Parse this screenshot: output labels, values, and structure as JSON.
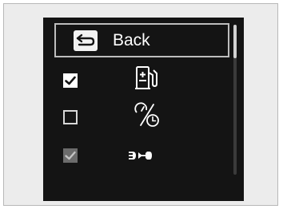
{
  "menu": {
    "back_label": "Back",
    "items": [
      {
        "icon": "fuel-economy-icon",
        "checked": true,
        "enabled": true
      },
      {
        "icon": "speed-time-icon",
        "checked": false,
        "enabled": true
      },
      {
        "icon": "headlight-indicator-icon",
        "checked": true,
        "enabled": false
      }
    ]
  },
  "colors": {
    "screen_bg": "#141414",
    "frame_bg": "#ececec",
    "highlight_border": "#bdbdbd",
    "text": "#ffffff",
    "disabled": "#6c6c6c"
  },
  "scroll": {
    "position": 0
  }
}
